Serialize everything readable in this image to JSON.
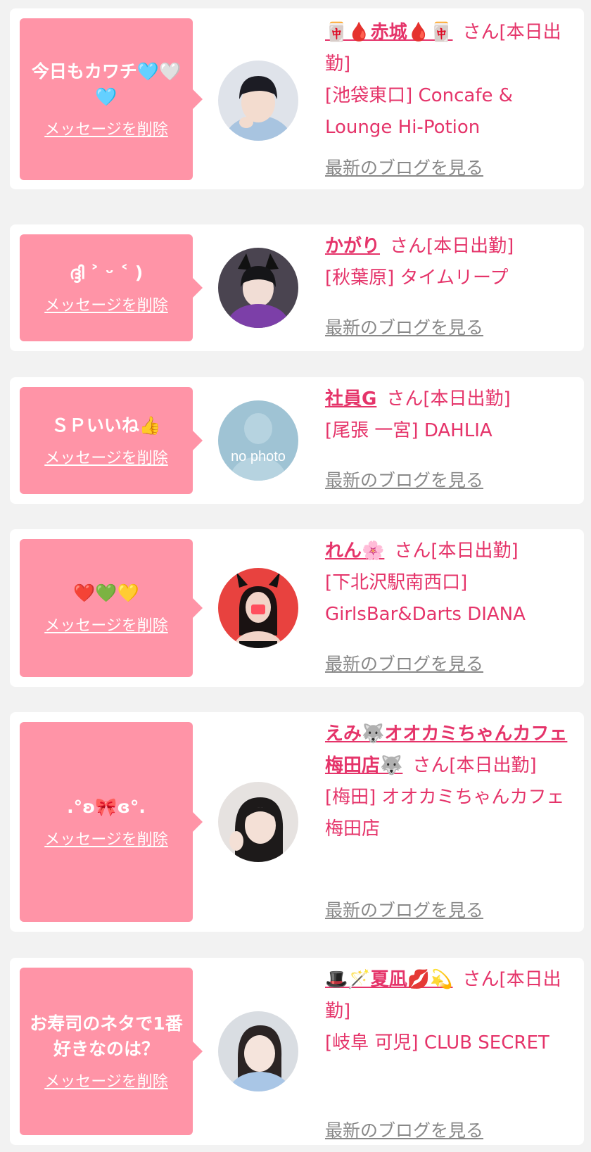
{
  "delete_label": "メッセージを削除",
  "blog_label": "最新のブログを見る",
  "suffix": "さん",
  "colors": {
    "bubble": "#ff94a7",
    "accent": "#e5346a",
    "link_gray": "#888888",
    "background": "#f2f2f2"
  },
  "entries": [
    {
      "message": "今日もカワチ🩵🤍🩵",
      "name": "🀄🩸赤城🩸🀄",
      "status": "[本日出勤]",
      "shop": "[池袋東口] Concafe & Lounge Hi-Potion",
      "avatar_icon": "cosplay-girl-photo"
    },
    {
      "message": "ദ്ദി ˃ ᵕ ˂ )",
      "name": "かがり",
      "status": "[本日出勤]",
      "shop": "[秋葉原] タイムリープ",
      "avatar_icon": "cat-ear-girl-photo"
    },
    {
      "message": "ＳＰいいね👍",
      "name": "社員G",
      "status": "[本日出勤]",
      "shop": "[尾張 一宮] DAHLIA",
      "avatar_icon": "no-photo",
      "avatar_text": "no photo"
    },
    {
      "message": "❤️💚💛",
      "name": "れん🌸",
      "status": "[本日出勤]",
      "shop": "[下北沢駅南西口] GirlsBar&Darts DIANA",
      "avatar_icon": "devil-horn-girl-photo"
    },
    {
      "message": ".°ʚ🎀ɞ°.",
      "name": "えみ🐺オオカミちゃんカフェ梅田店🐺",
      "status": "[本日出勤]",
      "shop": "[梅田] オオカミちゃんカフェ梅田店",
      "avatar_icon": "peace-sign-girl-photo"
    },
    {
      "message": "お寿司のネタで1番好きなのは？",
      "name": "🎩🪄夏凪💋💫",
      "status": "[本日出勤]",
      "shop": "[岐阜 可児] CLUB SECRET",
      "avatar_icon": "selfie-girl-photo"
    }
  ]
}
